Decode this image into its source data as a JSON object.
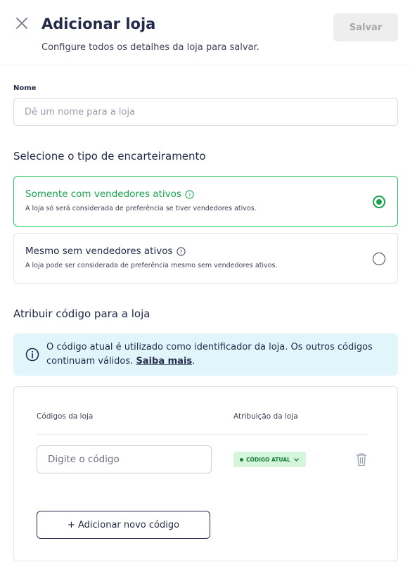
{
  "header": {
    "title": "Adicionar loja",
    "subtitle": "Configure todos os detalhes da loja para salvar.",
    "save_label": "Salvar"
  },
  "name_field": {
    "label": "Nome",
    "placeholder": "Dê um nome para a loja",
    "value": ""
  },
  "type_section": {
    "title": "Selecione o tipo de encarteiramento",
    "options": [
      {
        "title": "Somente com vendedores ativos",
        "description": "A loja só será considerada de preferência se tiver vendedores ativos.",
        "selected": true
      },
      {
        "title": "Mesmo sem vendedores ativos",
        "description": "A loja pode ser considerada de preferência mesmo sem vendedores ativos.",
        "selected": false
      }
    ]
  },
  "code_section": {
    "title": "Atribuir código para a loja",
    "info_text": "O código atual é utilizado como identificador da loja. Os outros códigos continuam válidos.",
    "info_link": "Saiba mais",
    "info_trailing": ".",
    "columns": [
      "Códigos da loja",
      "Atribuição da loja"
    ],
    "rows": [
      {
        "code_placeholder": "Digite o código",
        "code_value": "",
        "attribution": "CÓDIGO ATUAL"
      }
    ],
    "add_label": "+ Adicionar novo código"
  },
  "colors": {
    "accent_green": "#16a34a",
    "info_bg": "#e0f6fb",
    "navy": "#232a4a"
  },
  "icons": [
    "close-icon",
    "help-icon",
    "info-icon",
    "chevron-down-icon",
    "trash-icon"
  ]
}
